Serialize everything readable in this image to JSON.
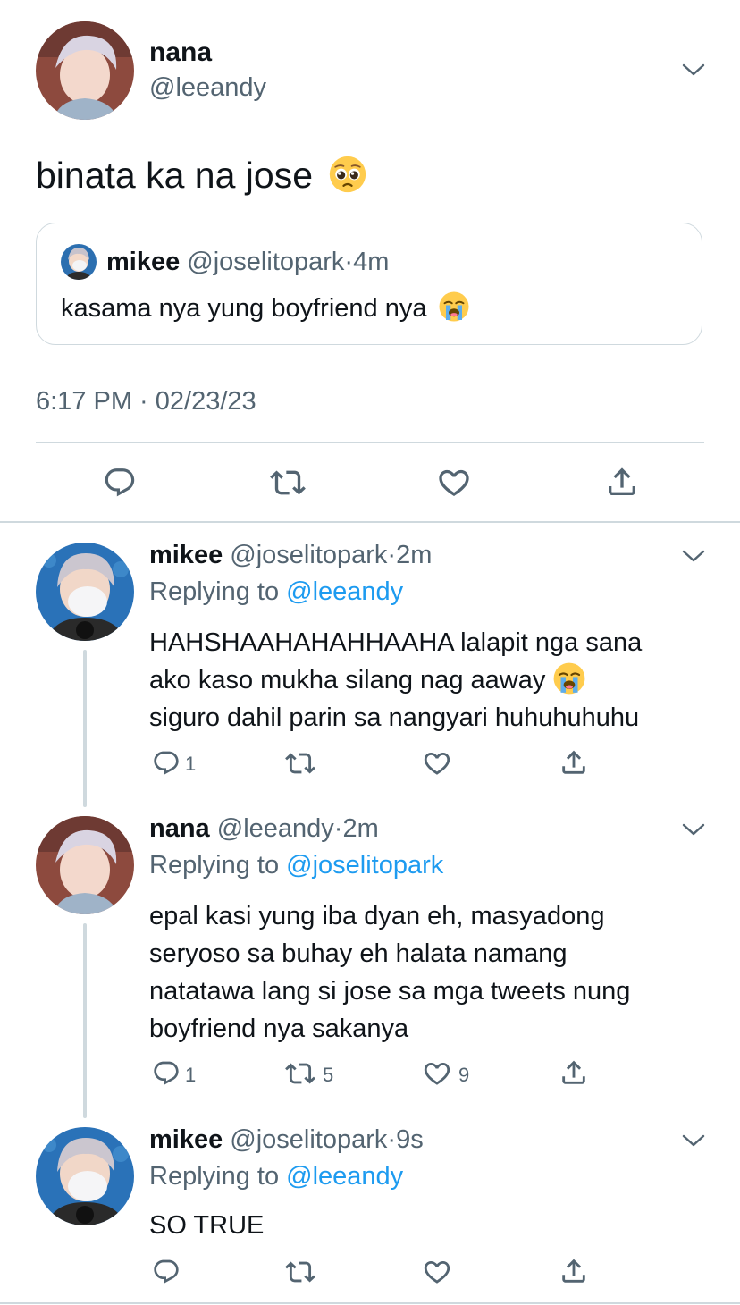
{
  "colors": {
    "accent": "#1d9bf0",
    "muted": "#536471",
    "text": "#0f1419",
    "divider": "#cfd9de"
  },
  "main_tweet": {
    "name": "nana",
    "handle": "@leeandy",
    "text": "binata ka na jose",
    "text_emoji": "pleading-face",
    "quote": {
      "name": "mikee",
      "handle": "@joselitopark",
      "sep": "·",
      "time": "4m",
      "text": "kasama nya yung boyfriend nya",
      "text_emoji": "loudly-crying-face"
    },
    "timestamp": "6:17 PM · 02/23/23",
    "actions": [
      "reply-icon",
      "retweet-icon",
      "like-icon",
      "share-icon"
    ]
  },
  "replies": [
    {
      "name": "mikee",
      "handle": "@joselitopark",
      "sep": "·",
      "time": "2m",
      "replying_label": "Replying to",
      "replying_to": "@leeandy",
      "lines": [
        "HAHSHAAHAHAHHAAHA lalapit nga sana",
        "ako kaso mukha silang nag aaway",
        "siguro dahil parin sa nangyari huhuhuhuhu"
      ],
      "line_emoji": "loudly-crying-face",
      "reply_count": "1",
      "retweet_count": "",
      "like_count": ""
    },
    {
      "name": "nana",
      "handle": "@leeandy",
      "sep": "·",
      "time": "2m",
      "replying_label": "Replying to",
      "replying_to": "@joselitopark",
      "lines": [
        "epal kasi yung iba dyan eh, masyadong",
        "seryoso sa buhay eh halata namang",
        "natatawa lang si jose sa mga tweets nung",
        "boyfriend nya sakanya"
      ],
      "reply_count": "1",
      "retweet_count": "5",
      "like_count": "9"
    },
    {
      "name": "mikee",
      "handle": "@joselitopark",
      "sep": "·",
      "time": "9s",
      "replying_label": "Replying to",
      "replying_to": "@leeandy",
      "lines": [
        "SO TRUE"
      ],
      "reply_count": "",
      "retweet_count": "",
      "like_count": ""
    }
  ]
}
